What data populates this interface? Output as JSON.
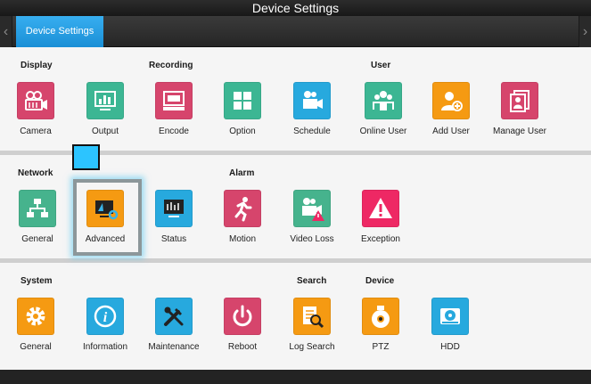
{
  "window": {
    "title": "Device Settings"
  },
  "tabs": {
    "active_label": "Device Settings",
    "left_arrow": "‹",
    "right_arrow": "›"
  },
  "sections": {
    "display": {
      "label": "Display"
    },
    "recording": {
      "label": "Recording"
    },
    "user": {
      "label": "User"
    },
    "network": {
      "label": "Network"
    },
    "alarm": {
      "label": "Alarm"
    },
    "system": {
      "label": "System"
    },
    "search": {
      "label": "Search"
    },
    "device": {
      "label": "Device"
    }
  },
  "items": {
    "camera": {
      "label": "Camera",
      "icon": "camera-settings-icon",
      "color": "#d6456c"
    },
    "output": {
      "label": "Output",
      "icon": "monitor-chart-icon",
      "color": "#3cb693"
    },
    "encode": {
      "label": "Encode",
      "icon": "encoder-icon",
      "color": "#d6456c"
    },
    "option": {
      "label": "Option",
      "icon": "grid-icon",
      "color": "#3cb693"
    },
    "schedule": {
      "label": "Schedule",
      "icon": "video-schedule-icon",
      "color": "#27a9de"
    },
    "online_user": {
      "label": "Online User",
      "icon": "users-icon",
      "color": "#3cb693"
    },
    "add_user": {
      "label": "Add User",
      "icon": "add-user-icon",
      "color": "#f59a12"
    },
    "manage_user": {
      "label": "Manage User",
      "icon": "manage-user-icon",
      "color": "#d6456c"
    },
    "network_general": {
      "label": "General",
      "icon": "network-icon",
      "color": "#46b38d"
    },
    "advanced": {
      "label": "Advanced",
      "icon": "monitor-gear-icon",
      "color": "#f59a12"
    },
    "status": {
      "label": "Status",
      "icon": "monitor-status-icon",
      "color": "#27a9de"
    },
    "motion": {
      "label": "Motion",
      "icon": "running-person-icon",
      "color": "#d6456c"
    },
    "video_loss": {
      "label": "Video Loss",
      "icon": "video-loss-icon",
      "color": "#46b38d"
    },
    "exception": {
      "label": "Exception",
      "icon": "warning-icon",
      "color": "#ee2864"
    },
    "system_general": {
      "label": "General",
      "icon": "gear-icon",
      "color": "#f59a12"
    },
    "information": {
      "label": "Information",
      "icon": "info-icon",
      "color": "#27a9de"
    },
    "maintenance": {
      "label": "Maintenance",
      "icon": "tools-icon",
      "color": "#27a9de"
    },
    "reboot": {
      "label": "Reboot",
      "icon": "power-icon",
      "color": "#d6456c"
    },
    "log_search": {
      "label": "Log Search",
      "icon": "log-search-icon",
      "color": "#f59a12"
    },
    "ptz": {
      "label": "PTZ",
      "icon": "ptz-camera-icon",
      "color": "#f59a12"
    },
    "hdd": {
      "label": "HDD",
      "icon": "hdd-icon",
      "color": "#27a9de"
    }
  },
  "selected_item": "Advanced"
}
